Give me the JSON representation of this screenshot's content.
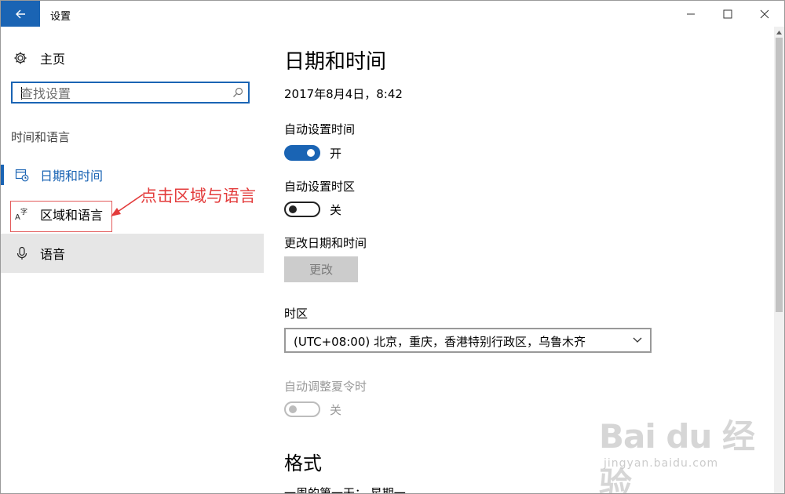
{
  "window": {
    "title": "设置"
  },
  "sidebar": {
    "home_label": "主页",
    "search_placeholder": "查找设置",
    "section_label": "时间和语言",
    "items": [
      {
        "label": "日期和时间",
        "icon": "calendar-clock-icon",
        "selected": true
      },
      {
        "label": "区域和语言",
        "icon": "language-icon"
      },
      {
        "label": "语音",
        "icon": "microphone-icon"
      }
    ]
  },
  "annotation": {
    "text": "点击区域与语言",
    "color": "#e33b3b"
  },
  "main": {
    "page_title": "日期和时间",
    "current_datetime": "2017年8月4日，8:42",
    "auto_time": {
      "label": "自动设置时间",
      "state": "开",
      "on": true
    },
    "auto_timezone": {
      "label": "自动设置时区",
      "state": "关",
      "on": false
    },
    "change_datetime": {
      "label": "更改日期和时间",
      "button": "更改"
    },
    "timezone": {
      "label": "时区",
      "value": "(UTC+08:00) 北京，重庆，香港特别行政区，乌鲁木齐"
    },
    "dst": {
      "label": "自动调整夏令时",
      "state": "关",
      "disabled": true
    },
    "format_title": "格式",
    "cutoff_text": "一周的第一天：  星期一"
  },
  "watermark": {
    "logo": "Bai du 经验",
    "url": "jingyan.baidu.com"
  },
  "colors": {
    "accent": "#1a64b4",
    "annotation": "#e33b3b",
    "selected_bg": "#e6e6e6"
  }
}
